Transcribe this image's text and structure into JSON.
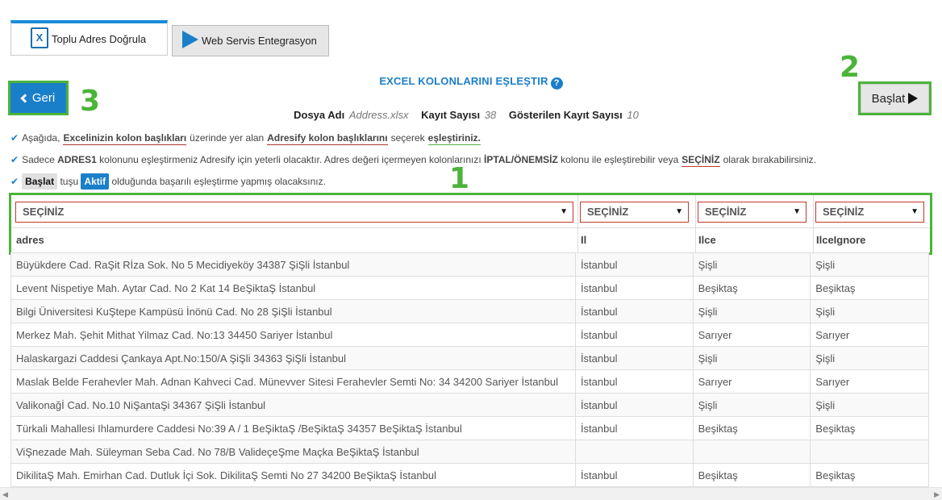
{
  "tabs": [
    {
      "label": "Toplu Adres Doğrula",
      "icon": "excel-file-icon",
      "icon_glyph": "X",
      "active": true
    },
    {
      "label": "Web Servis Entegrasyon",
      "icon": "play-icon",
      "active": false
    }
  ],
  "section_title": "EXCEL KOLONLARINI EŞLEŞTIR",
  "help_glyph": "?",
  "back_button": "Geri",
  "start_button": "Başlat",
  "callouts": {
    "one": "1",
    "two": "2",
    "three": "3"
  },
  "file_info": {
    "file_label": "Dosya Adı",
    "file_value": "Address.xlsx",
    "count_label": "Kayıt Sayısı",
    "count_value": "38",
    "shown_label": "Gösterilen Kayıt Sayısı",
    "shown_value": "10"
  },
  "instructions": {
    "line1": {
      "a": "Aşağıda,",
      "b": "Excelinizin kolon başlıkları",
      "c": "üzerinde yer alan",
      "d": "Adresify kolon başlıklarını",
      "e": "seçerek",
      "f": "eşleştiriniz."
    },
    "line2": {
      "a": "Sadece",
      "b": "ADRES1",
      "c": "kolonunu eşleştirmeniz Adresify için yeterli olacaktır. Adres değeri içermeyen kolonlarınızı",
      "d": "İPTAL/ÖNEMSİZ",
      "e": "kolonu ile eşleştirebilir veya",
      "f": "SEÇİNİZ",
      "g": "olarak bırakabilirsiniz."
    },
    "line3": {
      "a": "Başlat",
      "b": "tuşu",
      "c": "Aktif",
      "d": "olduğunda başarılı eşleştirme yapmış olacaksınız."
    }
  },
  "mapping": {
    "selects": [
      "SEÇİNİZ",
      "SEÇİNİZ",
      "SEÇİNİZ",
      "SEÇİNİZ"
    ],
    "headers": [
      "adres",
      "Il",
      "Ilce",
      "IlceIgnore"
    ]
  },
  "rows": [
    [
      "Büyükdere Cad. RaŞit Rİza Sok. No 5 Mecidiyeköy 34387 ŞiŞli İstanbul",
      "İstanbul",
      "Şişli",
      "Şişli"
    ],
    [
      "Levent Nispetiye Mah. Aytar Cad. No 2 Kat 14 BeŞiktaŞ İstanbul",
      "İstanbul",
      "Beşiktaş",
      "Beşiktaş"
    ],
    [
      "Bilgi Üniversitesi KuŞtepe Kampüsü İnönü Cad. No 28 ŞiŞli İstanbul",
      "İstanbul",
      "Şişli",
      "Şişli"
    ],
    [
      "Merkez Mah. Şehit Mithat Yilmaz Cad. No:13 34450 Sariyer İstanbul",
      "İstanbul",
      "Sarıyer",
      "Sarıyer"
    ],
    [
      "Halaskargazi Caddesi Çankaya Apt.No:150/A ŞiŞli 34363 ŞiŞli İstanbul",
      "İstanbul",
      "Şişli",
      "Şişli"
    ],
    [
      "Maslak Belde Ferahevler Mah. Adnan Kahveci Cad. Münevver Sitesi Ferahevler Semti No: 34 34200 Sariyer İstanbul",
      "İstanbul",
      "Sarıyer",
      "Sarıyer"
    ],
    [
      "Valikonağİ Cad. No.10 NiŞantaŞi 34367 ŞiŞli İstanbul",
      "İstanbul",
      "Şişli",
      "Şişli"
    ],
    [
      "Türkali Mahallesi Ihlamurdere Caddesi No:39 A / 1 BeŞiktaŞ /BeŞiktaŞ 34357 BeŞiktaŞ İstanbul",
      "İstanbul",
      "Beşiktaş",
      "Beşiktaş"
    ],
    [
      "ViŞnezade Mah. Süleyman Seba Cad. No 78/B ValideçeŞme Maçka BeŞiktaŞ İstanbul",
      "",
      "",
      ""
    ],
    [
      "DikilitaŞ Mah. Emirhan Cad. Dutluk İçi Sok. DikilitaŞ Semti No 27 34200 BeŞiktaŞ İstanbul",
      "İstanbul",
      "Beşiktaş",
      "Beşiktaş"
    ]
  ],
  "colors": {
    "accent": "#1a7fc9",
    "callout_green": "#4bb43a",
    "select_border": "#c0392b"
  }
}
